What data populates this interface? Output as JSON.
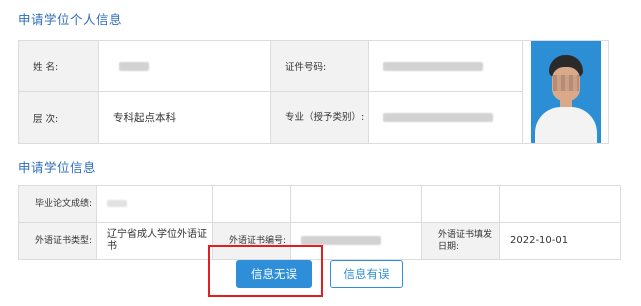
{
  "section_personal": {
    "title": "申请学位个人信息",
    "name_label": "姓  名:",
    "id_label": "证件号码:",
    "level_label": "层  次:",
    "level_value": "专科起点本科",
    "major_label": "专业（授予类别）:"
  },
  "section_degree": {
    "title": "申请学位信息",
    "thesis_label": "毕业论文成绩:",
    "lang_type_label": "外语证书类型:",
    "lang_type_value": "辽宁省成人学位外语证书",
    "lang_no_label": "外语证书编号:",
    "lang_date_label": "外语证书填发日期:",
    "lang_date_value": "2022-10-01"
  },
  "buttons": {
    "correct_label": "信息无误",
    "incorrect_label": "信息有误"
  },
  "colors": {
    "accent": "#2e8fd8",
    "title": "#2f6dbd",
    "highlight": "#e02020"
  }
}
